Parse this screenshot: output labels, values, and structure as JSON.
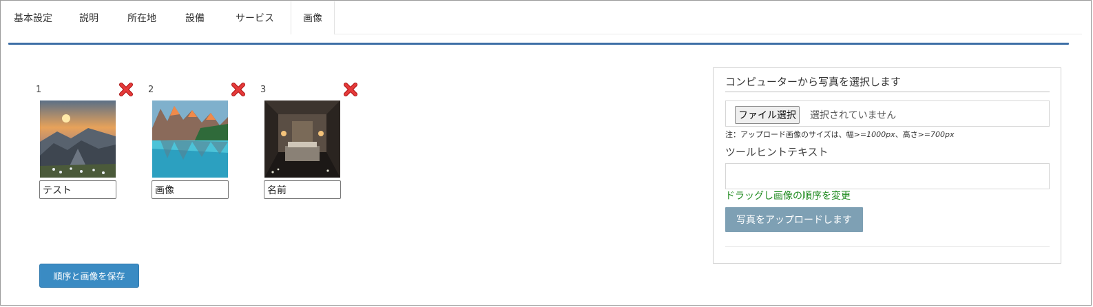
{
  "tabs": [
    {
      "label": "基本設定",
      "active": false
    },
    {
      "label": "説明",
      "active": false
    },
    {
      "label": "所在地",
      "active": false
    },
    {
      "label": "設備",
      "active": false
    },
    {
      "label": "サービス",
      "active": false
    },
    {
      "label": "画像",
      "active": true
    }
  ],
  "images": [
    {
      "number": "1",
      "name": "テスト",
      "scene": "mountain-sunset"
    },
    {
      "number": "2",
      "name": "画像",
      "scene": "mountain-lake"
    },
    {
      "number": "3",
      "name": "名前",
      "scene": "bedroom"
    }
  ],
  "save_button_label": "順序と画像を保存",
  "upload_panel": {
    "title": "コンピューターから写真を選択します",
    "file_button_label": "ファイル選択",
    "file_status": "選択されていません",
    "note_prefix": "注：アップロード画像のサイズは、幅",
    "note_width": ">=1000px",
    "note_middle": "、高さ",
    "note_height": ">=700px",
    "tooltip_label": "ツールヒントテキスト",
    "tooltip_value": "",
    "drag_note": "ドラッグし画像の順序を変更",
    "upload_button_label": "写真をアップロードします"
  },
  "colors": {
    "tab_rule": "#3d6fa6",
    "save_button": "#3a8bc3",
    "upload_button": "#7ea0b4",
    "drag_note": "#1f8a1f",
    "delete_icon": "#d42a2a"
  },
  "icons": {
    "delete": "close-x-icon"
  }
}
